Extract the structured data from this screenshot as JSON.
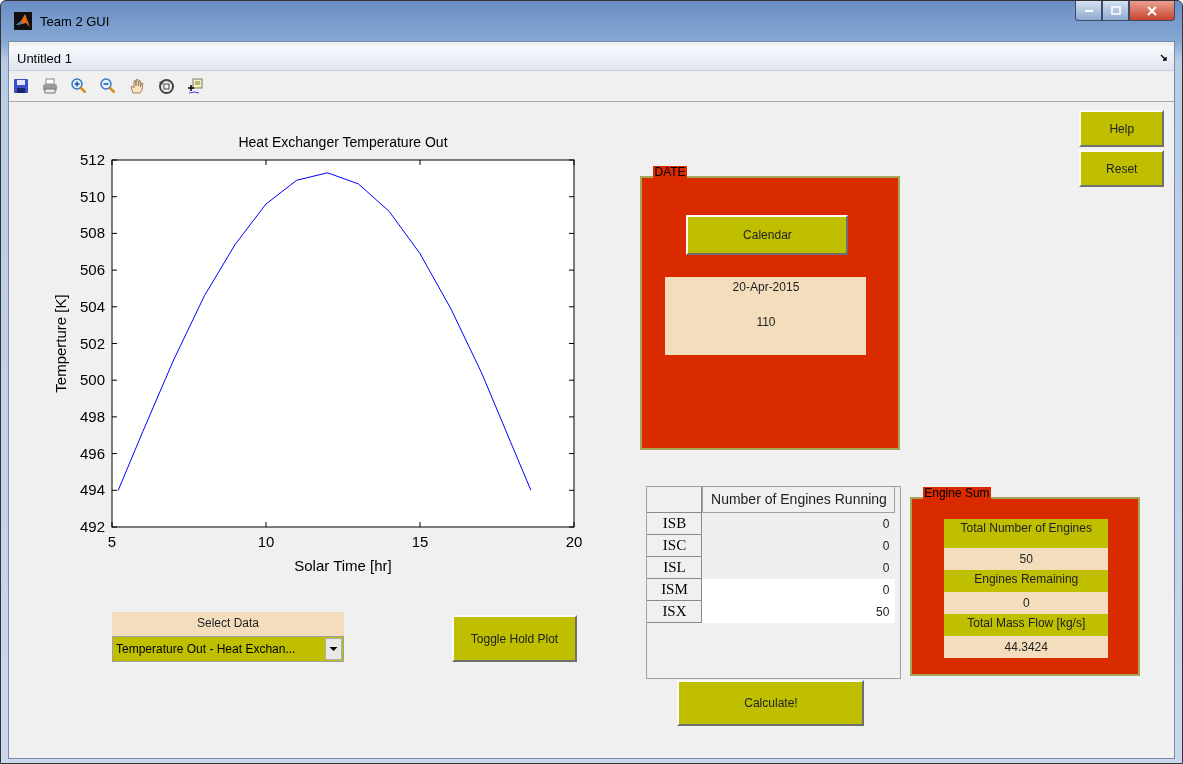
{
  "window": {
    "title": "Team 2 GUI"
  },
  "menu_bar": {
    "title": "Untitled 1"
  },
  "toolbar": [
    {
      "kind": "save"
    },
    {
      "kind": "print"
    },
    {
      "kind": "zoom_in"
    },
    {
      "kind": "zoom_out"
    },
    {
      "kind": "pan"
    },
    {
      "kind": "rotate"
    },
    {
      "kind": "data_cursor"
    }
  ],
  "plot": {
    "chart_data": {
      "type": "line",
      "title": "Heat Exchanger Temperature Out",
      "xlabel": "Solar Time [hr]",
      "ylabel": "Temperture [K]",
      "xlim": [
        5,
        20
      ],
      "ylim": [
        492,
        512
      ],
      "xticks": [
        5,
        10,
        15,
        20
      ],
      "yticks": [
        492,
        494,
        496,
        498,
        500,
        502,
        504,
        506,
        508,
        510,
        512
      ],
      "x": [
        5.2,
        6,
        7,
        8,
        9,
        10,
        11,
        12,
        13,
        14,
        15,
        16,
        17,
        18,
        18.6
      ],
      "series": [
        {
          "color": "#0000ff",
          "values": [
            494.0,
            497.2,
            501.1,
            504.6,
            507.4,
            509.6,
            510.9,
            511.3,
            510.7,
            509.2,
            506.9,
            503.9,
            500.4,
            496.4,
            494.0
          ]
        }
      ]
    }
  },
  "select_data": {
    "label": "Select Data",
    "value": "Temperature Out - Heat Exchan..."
  },
  "toggle_button": "Toggle Hold Plot",
  "date_panel": {
    "title": "DATE",
    "button": "Calendar",
    "date": "20-Apr-2015",
    "day_of_year": "110"
  },
  "engine_table": {
    "columns": [
      "Number of Engines Running"
    ],
    "rows": [
      {
        "name": "ISB",
        "value": "0"
      },
      {
        "name": "ISC",
        "value": "0"
      },
      {
        "name": "ISL",
        "value": "0"
      },
      {
        "name": "ISM",
        "value": "0"
      },
      {
        "name": "ISX",
        "value": "50"
      }
    ]
  },
  "calculate_button": "Calculate!",
  "side_buttons": [
    "Help",
    "Reset"
  ],
  "engine_sum": {
    "title": "Engine Sum",
    "items": [
      {
        "label": "Total Number of Engines",
        "value": "50"
      },
      {
        "label": "Engines Remaining",
        "value": "0"
      },
      {
        "label": "Total Mass Flow [kg/s]",
        "value": "44.3424"
      }
    ]
  }
}
